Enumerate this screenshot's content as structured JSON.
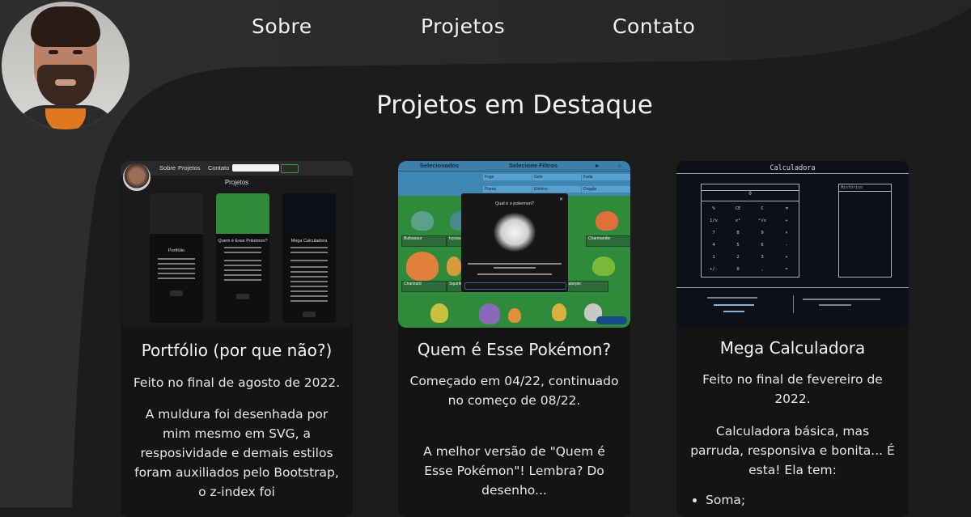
{
  "nav": {
    "items": [
      "Sobre",
      "Projetos",
      "Contato"
    ]
  },
  "section_title": "Projetos em Destaque",
  "cards": [
    {
      "title": "Portfólio (por que não?)",
      "paragraphs": [
        "Feito no final de agosto de 2022.",
        "A muldura foi desenhada por mim mesmo em SVG, a resposividade e demais estilos foram auxiliados pelo Bootstrap, o z-index foi"
      ],
      "thumb": {
        "nav": [
          "Sobre",
          "Projetos",
          "Contato"
        ],
        "search_label": "Search",
        "title": "Projetos",
        "cards": [
          "Portfólio",
          "Quem é Esse Pokémon?",
          "Mega Calculadora"
        ],
        "view_label": "Visitar"
      }
    },
    {
      "title": "Quem é Esse Pokémon?",
      "paragraphs": [
        "Começado em 04/22, continuado no começo de 08/22.",
        "A melhor versão de \"Quem é Esse Pokémon\"! Lembra? Do desenho..."
      ],
      "thumb": {
        "header_left": "Selecionados",
        "header_mid": "Selecione Filtros",
        "filters": [
          "Fogo",
          "Gelo",
          "Fada",
          "Planta",
          "Elétrico",
          "Dragão"
        ],
        "modal_title": "Qual é o pokemon?",
        "pokemon_labels": [
          "Bulbasaur",
          "Ivysaur",
          "Charmander",
          "Charizard",
          "Squirtle",
          "Caterpie"
        ]
      }
    },
    {
      "title": "Mega Calculadora",
      "paragraphs": [
        "Feito no final de fevereiro de 2022.",
        "Calculadora básica, mas parruda, responsiva e bonita... É esta! Ela tem:"
      ],
      "list": [
        "Soma;"
      ],
      "thumb": {
        "title": "Calculadora",
        "display_value": "0",
        "history_label": "Histórico",
        "keys": [
          "%",
          "CE",
          "C",
          "⌫",
          "1/x",
          "x²",
          "²√x",
          "÷",
          "7",
          "8",
          "9",
          "×",
          "4",
          "5",
          "6",
          "-",
          "1",
          "2",
          "3",
          "+",
          "+/-",
          "0",
          ",",
          "="
        ]
      }
    }
  ],
  "colors": {
    "background": "#1c1c1c",
    "frame_shape": "#2b2b2b",
    "card": "#141414",
    "accent_orange": "#e07820"
  }
}
